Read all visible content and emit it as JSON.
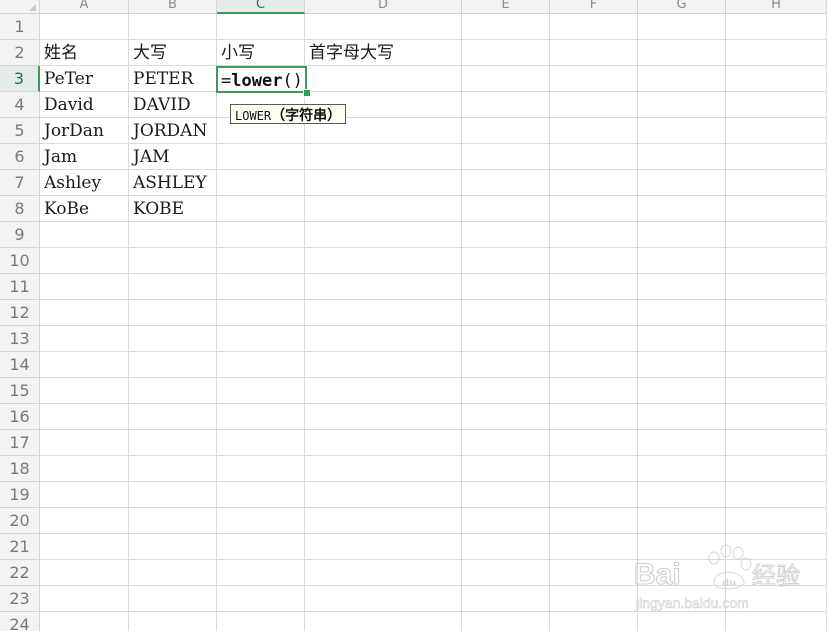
{
  "columns": [
    "A",
    "B",
    "C",
    "D",
    "E",
    "F",
    "G",
    "H"
  ],
  "active_column": "C",
  "rows": [
    "1",
    "2",
    "3",
    "4",
    "5",
    "6",
    "7",
    "8",
    "9",
    "10",
    "11",
    "12",
    "13",
    "14",
    "15",
    "16",
    "17",
    "18",
    "19",
    "20",
    "21",
    "22",
    "23",
    "24"
  ],
  "active_row": "3",
  "cells": {
    "A2": "姓名",
    "B2": "大写",
    "C2": "小写",
    "D2": "首字母大写",
    "A3": "PeTer",
    "B3": "PETER",
    "A4": "David",
    "B4": "DAVID",
    "A5": "JorDan",
    "B5": "JORDAN",
    "A6": "Jam",
    "B6": "JAM",
    "A7": "Ashley",
    "B7": "ASHLEY",
    "A8": "KoBe",
    "B8": "KOBE"
  },
  "editor": {
    "prefix": "=",
    "function": "lower",
    "parens": "()"
  },
  "tooltip": {
    "function": "LOWER",
    "argument": "（字符串）"
  },
  "watermark": {
    "brand": "Bai",
    "brand_cjk": "经验",
    "url": "jingyan.baidu.com"
  },
  "colors": {
    "accent_green": "#3c9a5f",
    "header_bg": "#f3f3f3",
    "gridline": "#dadada"
  }
}
